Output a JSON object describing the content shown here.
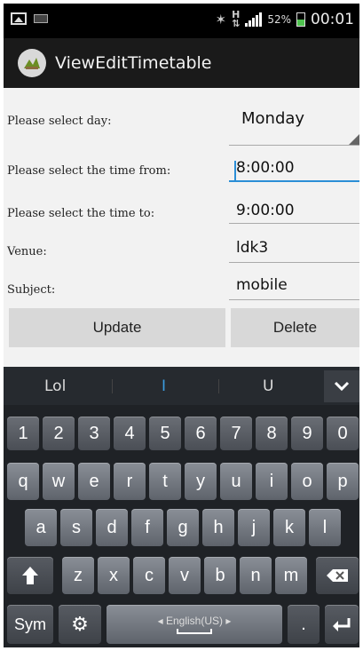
{
  "status": {
    "battery_percent_text": "52%",
    "battery_level": 52,
    "time": "00:01"
  },
  "app": {
    "title": "ViewEditTimetable"
  },
  "form": {
    "day_label": "Please select day:",
    "day_value": "Monday",
    "time_from_label": "Please select the time from:",
    "time_from_value": "8:00:00",
    "time_to_label": "Please select the time to:",
    "time_to_value": "9:00:00",
    "venue_label": "Venue:",
    "venue_value": "ldk3",
    "subject_label": "Subject:",
    "subject_value": "mobile",
    "update_label": "Update",
    "delete_label": "Delete"
  },
  "keyboard": {
    "suggestions": [
      "Lol",
      "I",
      "U"
    ],
    "number_row": [
      "1",
      "2",
      "3",
      "4",
      "5",
      "6",
      "7",
      "8",
      "9",
      "0"
    ],
    "row1": [
      "q",
      "w",
      "e",
      "r",
      "t",
      "y",
      "u",
      "i",
      "o",
      "p"
    ],
    "row2": [
      "a",
      "s",
      "d",
      "f",
      "g",
      "h",
      "j",
      "k",
      "l"
    ],
    "row3": [
      "z",
      "x",
      "c",
      "v",
      "b",
      "n",
      "m"
    ],
    "sym_label": "Sym",
    "space_label": "English(US)",
    "period_label": "."
  },
  "colors": {
    "accent": "#2b8ed6",
    "battery": "#4fc24f"
  }
}
